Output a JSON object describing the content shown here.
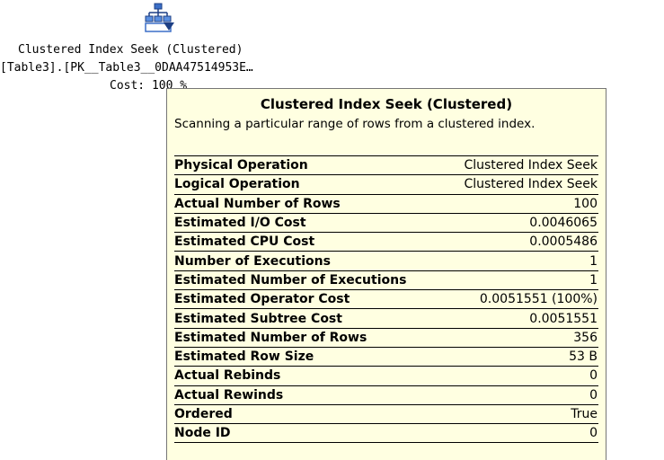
{
  "plan_node": {
    "icon": "clustered-index-seek-icon",
    "title": "Clustered Index Seek (Clustered)",
    "object": "[Table3].[PK__Table3__0DAA47514953E…",
    "cost": "Cost: 100 %"
  },
  "tooltip": {
    "title": "Clustered Index Seek (Clustered)",
    "description": "Scanning a particular range of rows from a clustered index.",
    "rows": [
      {
        "key": "Physical Operation",
        "value": "Clustered Index Seek"
      },
      {
        "key": "Logical Operation",
        "value": "Clustered Index Seek"
      },
      {
        "key": "Actual Number of Rows",
        "value": "100"
      },
      {
        "key": "Estimated I/O Cost",
        "value": "0.0046065"
      },
      {
        "key": "Estimated CPU Cost",
        "value": "0.0005486"
      },
      {
        "key": "Number of Executions",
        "value": "1"
      },
      {
        "key": "Estimated Number of Executions",
        "value": "1"
      },
      {
        "key": "Estimated Operator Cost",
        "value": "0.0051551 (100%)"
      },
      {
        "key": "Estimated Subtree Cost",
        "value": "0.0051551"
      },
      {
        "key": "Estimated Number of Rows",
        "value": "356"
      },
      {
        "key": "Estimated Row Size",
        "value": "53 B"
      },
      {
        "key": "Actual Rebinds",
        "value": "0"
      },
      {
        "key": "Actual Rewinds",
        "value": "0"
      },
      {
        "key": "Ordered",
        "value": "True"
      },
      {
        "key": "Node ID",
        "value": "0"
      }
    ]
  },
  "colors": {
    "tooltip_background": "#ffffe1",
    "icon_blue": "#3b6fc7"
  }
}
